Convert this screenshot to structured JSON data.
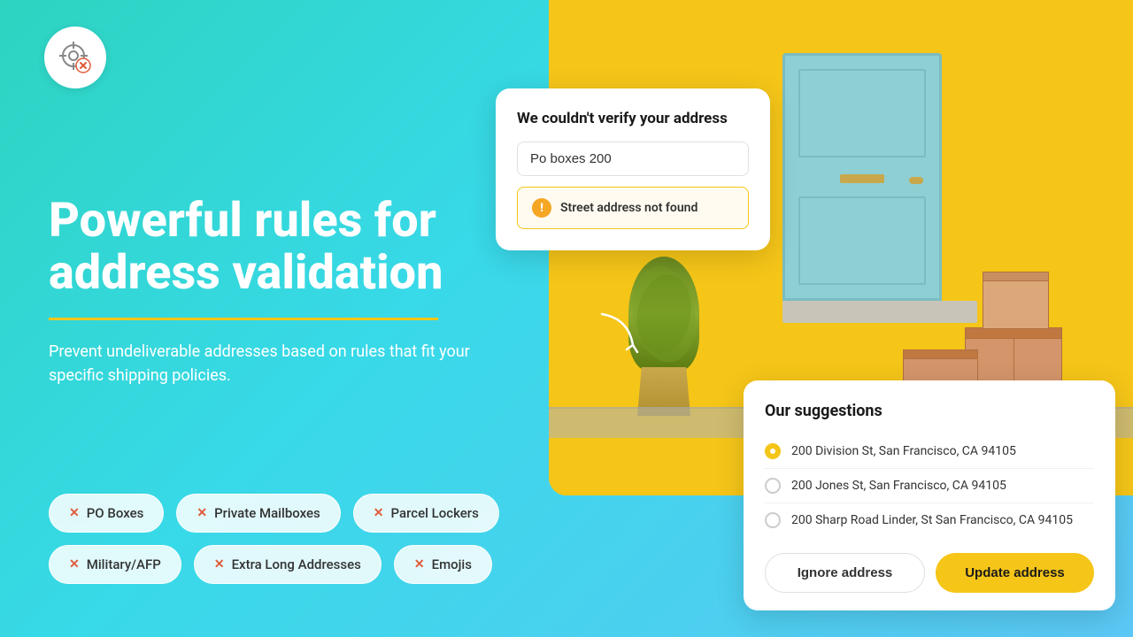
{
  "logo": {
    "alt": "Address validation logo"
  },
  "hero": {
    "title_line1": "Powerful rules for",
    "title_line2": "address validation",
    "subtitle": "Prevent undeliverable addresses based on\nrules that fit your specific shipping policies."
  },
  "tags": [
    {
      "label": "PO Boxes"
    },
    {
      "label": "Private Mailboxes"
    },
    {
      "label": "Parcel Lockers"
    },
    {
      "label": "Military/AFP"
    },
    {
      "label": "Extra Long Addresses"
    },
    {
      "label": "Emojis"
    }
  ],
  "verify_card": {
    "title": "We couldn't verify your address",
    "input_value": "Po boxes 200",
    "error_text": "Street address not found"
  },
  "suggestions_card": {
    "title": "Our suggestions",
    "items": [
      {
        "label": "200 Division St, San Francisco, CA 94105",
        "selected": true
      },
      {
        "label": "200 Jones St, San Francisco, CA 94105",
        "selected": false
      },
      {
        "label": "200 Sharp Road Linder, St San Francisco, CA 94105",
        "selected": false
      }
    ],
    "btn_ignore": "Ignore address",
    "btn_update": "Update address"
  }
}
